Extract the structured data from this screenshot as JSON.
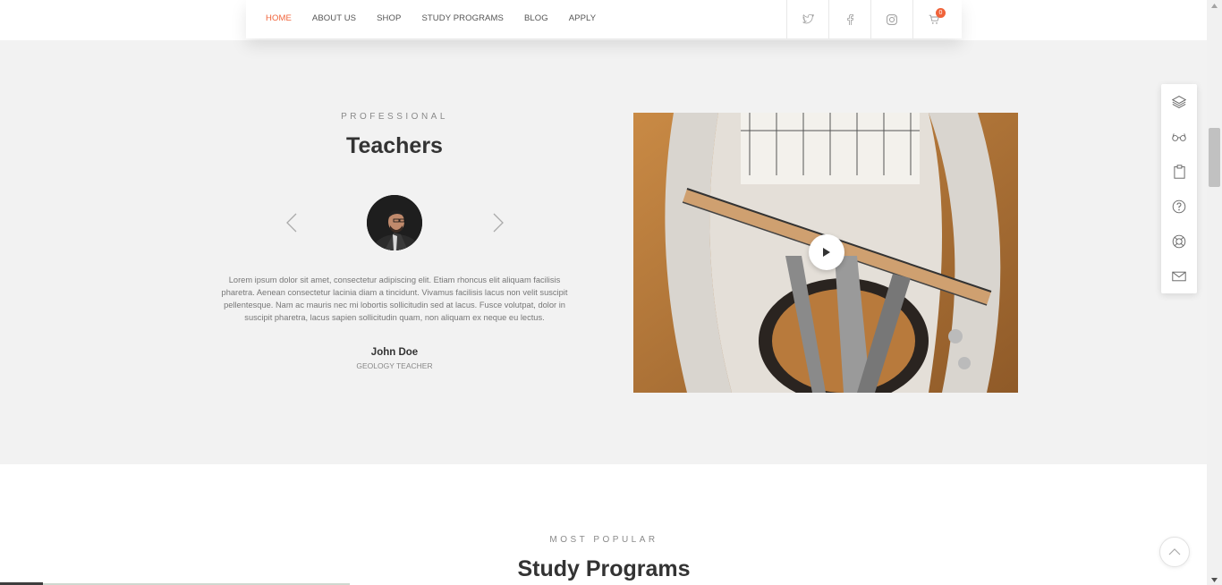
{
  "nav": {
    "items": [
      {
        "label": "HOME",
        "active": true
      },
      {
        "label": "ABOUT US",
        "active": false
      },
      {
        "label": "SHOP",
        "active": false
      },
      {
        "label": "STUDY PROGRAMS",
        "active": false
      },
      {
        "label": "BLOG",
        "active": false
      },
      {
        "label": "APPLY",
        "active": false
      }
    ],
    "icons": [
      "twitter-icon",
      "facebook-icon",
      "instagram-icon",
      "cart-icon"
    ],
    "cart_count": "0",
    "accent_color": "#f0633a"
  },
  "teachers": {
    "eyebrow": "PROFESSIONAL",
    "heading": "Teachers",
    "quote": "Lorem ipsum dolor sit amet, consectetur adipiscing elit. Etiam rhoncus elit aliquam facilisis pharetra. Aenean consectetur lacinia diam a tincidunt. Vivamus facilisis lacus non velit suscipit pellentesque. Nam ac mauris nec mi lobortis sollicitudin sed at lacus. Fusce volutpat, dolor in suscipit pharetra, lacus sapien sollicitudin quam, non aliquam ex neque eu lectus.",
    "name": "John Doe",
    "role": "GEOLOGY TEACHER"
  },
  "side_panel": {
    "icons": [
      "layers-icon",
      "glasses-icon",
      "clipboard-icon",
      "question-icon",
      "lifebuoy-icon",
      "mail-icon"
    ]
  },
  "popular": {
    "eyebrow": "MOST POPULAR",
    "heading": "Study Programs"
  }
}
